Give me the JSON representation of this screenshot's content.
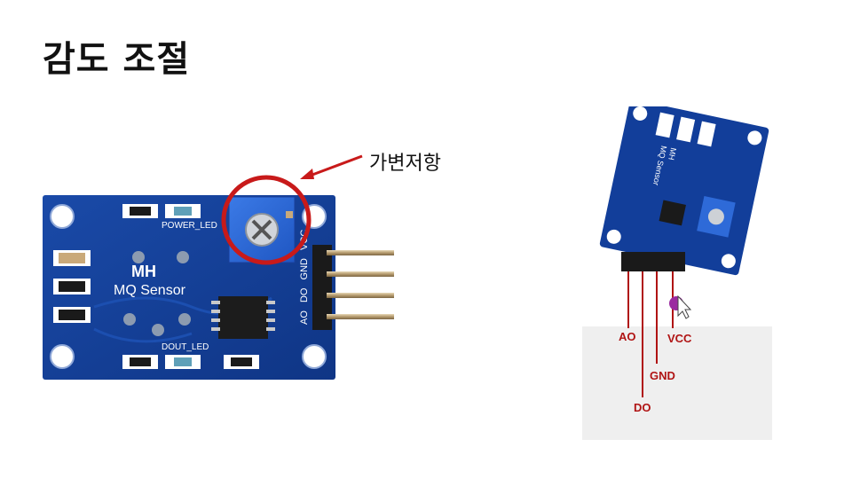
{
  "slide": {
    "title": "감도 조절"
  },
  "board_photo": {
    "brand": "MH",
    "model": "MQ Sensor",
    "power_led_label": "POWER_LED",
    "dout_led_label": "DOUT_LED",
    "header_pins": [
      "VCC",
      "GND",
      "DO",
      "AO"
    ],
    "board_color": "#123e9a"
  },
  "callout": {
    "label": "가변저항",
    "color": "#c81a1a"
  },
  "pinout_photo": {
    "brand": "MH",
    "model": "MQ Sensor",
    "pins": {
      "ao": "AO",
      "do": "DO",
      "gnd": "GND",
      "vcc": "VCC"
    },
    "wire_color": "#b01414"
  }
}
